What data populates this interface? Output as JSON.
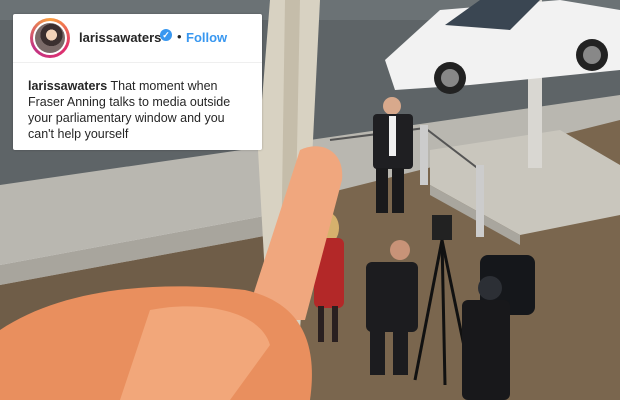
{
  "post": {
    "username": "larissawaters",
    "verified_glyph": "✓",
    "separator": "•",
    "follow_label": "Follow",
    "caption_user": "larissawaters",
    "caption_text": "That moment when Fraser Anning talks to media outside your parliamentary window and you can't help yourself"
  },
  "colors": {
    "verified_blue": "#3897f0",
    "follow_blue": "#3897f0",
    "text": "#262626"
  },
  "icons": [
    "verified-badge-icon",
    "avatar-photo"
  ]
}
